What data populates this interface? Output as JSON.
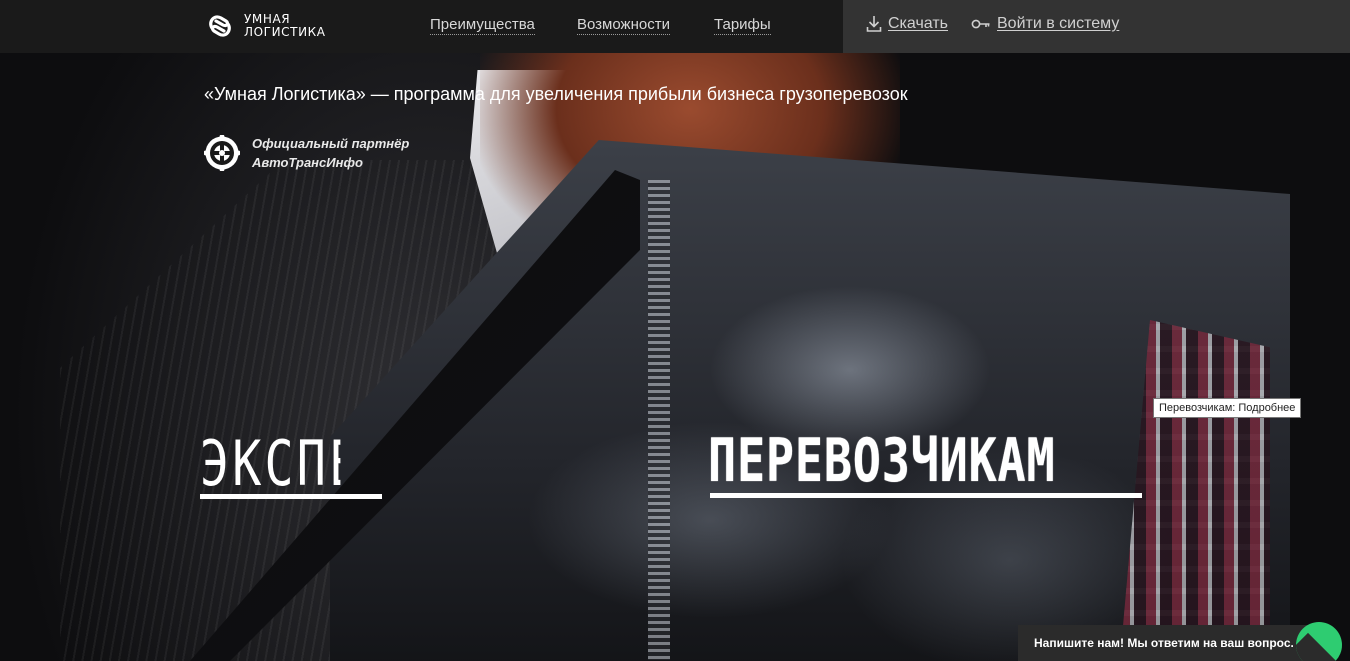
{
  "header": {
    "logo": {
      "line1": "Умная",
      "line2": "Логистика",
      "icon": "logo-mark-icon"
    },
    "nav": [
      {
        "label": "Преимущества"
      },
      {
        "label": "Возможности"
      },
      {
        "label": "Тарифы"
      }
    ],
    "download": {
      "label": "Скачать",
      "icon": "download-icon"
    },
    "login": {
      "label": "Войти в систему",
      "icon": "key-icon"
    }
  },
  "hero": {
    "tagline": "«Умная Логистика» — программа для увеличения прибыли бизнеса грузоперевозок",
    "partner": {
      "line1": "Официальный партнёр",
      "line2": "АвтоТрансИнфо",
      "icon": "ati-badge-icon"
    },
    "left_word": "ЭКСПЕ",
    "right_word": "ПЕРЕВОЗЧИКАМ",
    "tooltip": "Перевозчикам: Подробнее"
  },
  "chat": {
    "label": "Напишите нам! Мы ответим на ваш вопрос."
  },
  "colors": {
    "topbar": "#1a1a1a",
    "topbar_right": "#333333",
    "chat_accent": "#2ecc71"
  }
}
